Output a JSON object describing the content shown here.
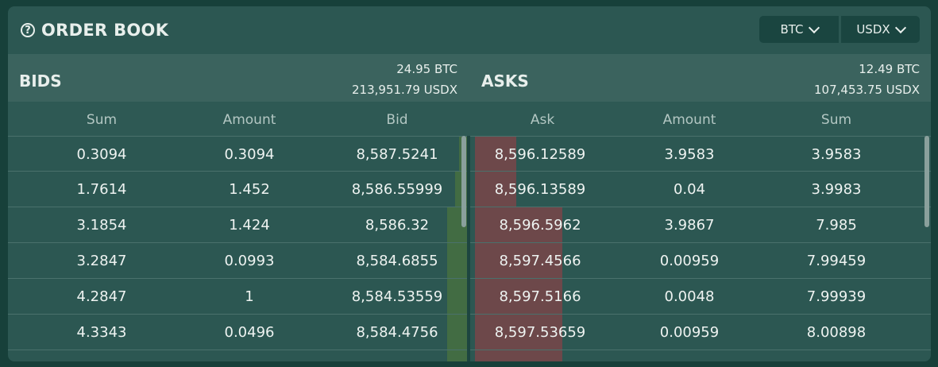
{
  "header": {
    "title": "ORDER BOOK",
    "help_icon": "?",
    "base_currency": "BTC",
    "quote_currency": "USDX"
  },
  "bids": {
    "label": "BIDS",
    "total_base": "24.95 BTC",
    "total_quote": "213,951.79 USDX",
    "columns": [
      "Sum",
      "Amount",
      "Bid"
    ],
    "rows": [
      {
        "sum": "0.3094",
        "amount": "0.3094",
        "price": "8,587.5241"
      },
      {
        "sum": "1.7614",
        "amount": "1.452",
        "price": "8,586.55999"
      },
      {
        "sum": "3.1854",
        "amount": "1.424",
        "price": "8,586.32"
      },
      {
        "sum": "3.2847",
        "amount": "0.0993",
        "price": "8,584.6855"
      },
      {
        "sum": "4.2847",
        "amount": "1",
        "price": "8,584.53559"
      },
      {
        "sum": "4.3343",
        "amount": "0.0496",
        "price": "8,584.4756"
      }
    ]
  },
  "asks": {
    "label": "ASKS",
    "total_base": "12.49 BTC",
    "total_quote": "107,453.75 USDX",
    "columns": [
      "Ask",
      "Amount",
      "Sum"
    ],
    "rows": [
      {
        "price": "8,596.12589",
        "amount": "3.9583",
        "sum": "3.9583"
      },
      {
        "price": "8,596.13589",
        "amount": "0.04",
        "sum": "3.9983"
      },
      {
        "price": "8,596.5962",
        "amount": "3.9867",
        "sum": "7.985"
      },
      {
        "price": "8,597.4566",
        "amount": "0.00959",
        "sum": "7.99459"
      },
      {
        "price": "8,597.5166",
        "amount": "0.0048",
        "sum": "7.99939"
      },
      {
        "price": "8,597.53659",
        "amount": "0.00959",
        "sum": "8.00898"
      }
    ]
  },
  "colors": {
    "bid_depth": "#557d37",
    "ask_depth": "#a43c44",
    "panel": "#2c5752",
    "background": "#17403a"
  }
}
